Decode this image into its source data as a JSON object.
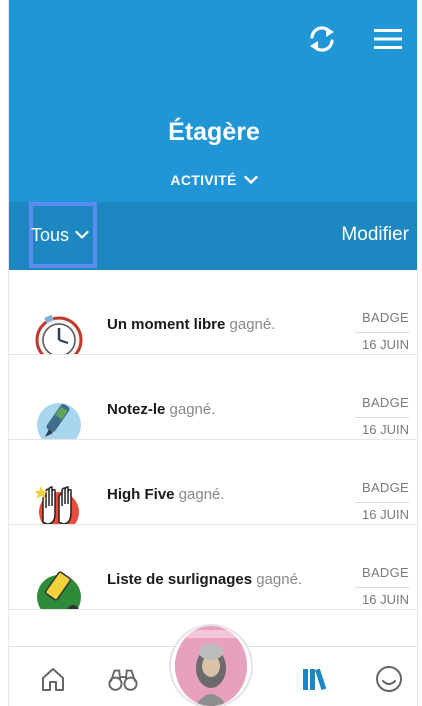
{
  "header": {
    "title": "Étagère",
    "activity_label": "ACTIVITÉ",
    "sync_icon": "sync-icon",
    "menu_icon": "hamburger-menu-icon"
  },
  "filter": {
    "selected": "Tous",
    "modify_label": "Modifier"
  },
  "activities": [
    {
      "name": "Un moment libre",
      "verb": "gagné.",
      "kind": "BADGE",
      "date": "16 JUIN",
      "icon": "clock-badge-icon"
    },
    {
      "name": "Notez-le",
      "verb": "gagné.",
      "kind": "BADGE",
      "date": "16 JUIN",
      "icon": "pen-badge-icon"
    },
    {
      "name": "High Five",
      "verb": "gagné.",
      "kind": "BADGE",
      "date": "16 JUIN",
      "icon": "high-five-badge-icon"
    },
    {
      "name": "Liste de surlignages",
      "verb": "gagné.",
      "kind": "BADGE",
      "date": "16 JUIN",
      "icon": "highlighter-badge-icon"
    }
  ],
  "nav": {
    "home": "home-icon",
    "discover": "binoculars-icon",
    "current_book": "current-book-cover",
    "library": "library-icon",
    "profile": "profile-icon"
  },
  "colors": {
    "header_blue": "#2196d6",
    "filter_blue": "#1d87c2",
    "focus_outline": "#5c8cf0",
    "library_active": "#1d87c2"
  }
}
